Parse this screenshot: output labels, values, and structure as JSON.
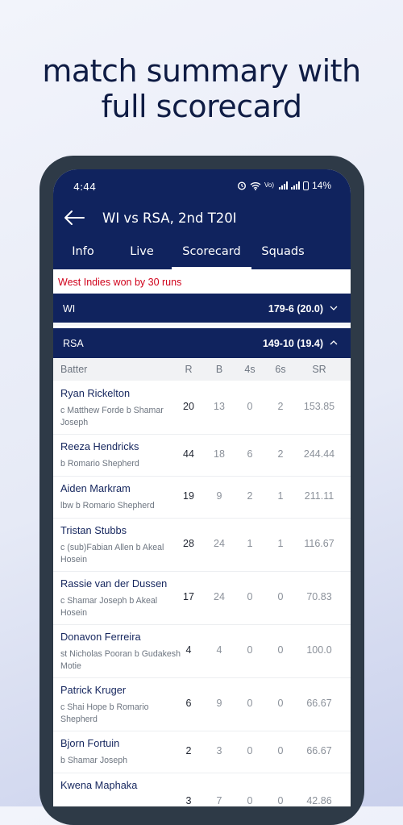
{
  "headline": {
    "line1": "match summary with",
    "line2": "full scorecard"
  },
  "status_bar": {
    "time": "4:44",
    "battery": "14%",
    "network_label": "Vo) LTE"
  },
  "header": {
    "title": "WI vs RSA, 2nd T20I"
  },
  "tabs": [
    {
      "label": "Info",
      "active": false
    },
    {
      "label": "Live",
      "active": false
    },
    {
      "label": "Scorecard",
      "active": true
    },
    {
      "label": "Squads",
      "active": false
    }
  ],
  "result_text": "West Indies won by 30 runs",
  "innings": [
    {
      "team": "WI",
      "score": "179-6 (20.0)",
      "expanded": false
    },
    {
      "team": "RSA",
      "score": "149-10 (19.4)",
      "expanded": true
    }
  ],
  "columns": {
    "batter": "Batter",
    "r": "R",
    "b": "B",
    "fours": "4s",
    "sixes": "6s",
    "sr": "SR"
  },
  "batters": [
    {
      "name": "Ryan Rickelton",
      "dismissal": "c Matthew Forde b Shamar Joseph",
      "r": "20",
      "b": "13",
      "fours": "0",
      "sixes": "2",
      "sr": "153.85"
    },
    {
      "name": "Reeza Hendricks",
      "dismissal": " b Romario Shepherd",
      "r": "44",
      "b": "18",
      "fours": "6",
      "sixes": "2",
      "sr": "244.44"
    },
    {
      "name": "Aiden Markram",
      "dismissal": "lbw b Romario Shepherd",
      "r": "19",
      "b": "9",
      "fours": "2",
      "sixes": "1",
      "sr": "211.11"
    },
    {
      "name": "Tristan Stubbs",
      "dismissal": "c (sub)Fabian Allen b Akeal Hosein",
      "r": "28",
      "b": "24",
      "fours": "1",
      "sixes": "1",
      "sr": "116.67"
    },
    {
      "name": "Rassie van der Dussen",
      "dismissal": "c Shamar Joseph b Akeal Hosein",
      "r": "17",
      "b": "24",
      "fours": "0",
      "sixes": "0",
      "sr": "70.83"
    },
    {
      "name": "Donavon Ferreira",
      "dismissal": "st Nicholas Pooran b Gudakesh Motie",
      "r": "4",
      "b": "4",
      "fours": "0",
      "sixes": "0",
      "sr": "100.0"
    },
    {
      "name": "Patrick Kruger",
      "dismissal": "c Shai Hope b Romario Shepherd",
      "r": "6",
      "b": "9",
      "fours": "0",
      "sixes": "0",
      "sr": "66.67"
    },
    {
      "name": "Bjorn Fortuin",
      "dismissal": " b Shamar Joseph",
      "r": "2",
      "b": "3",
      "fours": "0",
      "sixes": "0",
      "sr": "66.67"
    },
    {
      "name": "Kwena Maphaka",
      "dismissal": "",
      "r": "3",
      "b": "7",
      "fours": "0",
      "sixes": "0",
      "sr": "42.86"
    }
  ],
  "colors": {
    "navy": "#10235e",
    "result_red": "#d0021b",
    "frame": "#2e3a47"
  }
}
